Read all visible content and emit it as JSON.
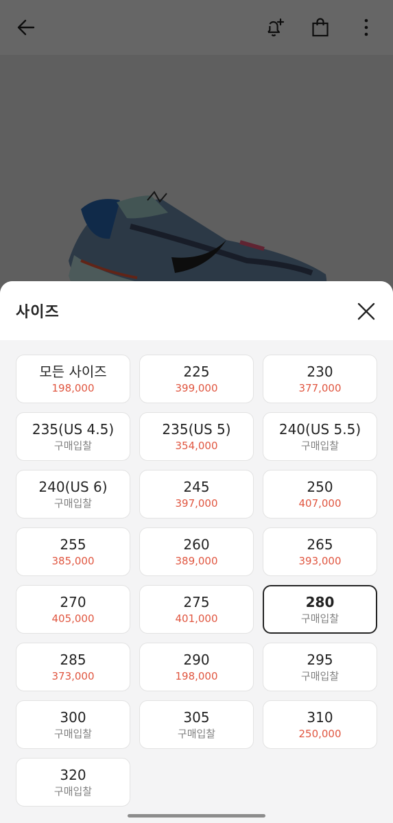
{
  "sheet": {
    "title": "사이즈",
    "close_icon": "close-icon"
  },
  "colors": {
    "price": "#e0553f",
    "bid": "#7f7f7f",
    "selected_border": "#222222"
  },
  "topbar_icons": [
    "back-arrow-icon",
    "bell-plus-icon",
    "shopping-bag-icon",
    "more-vertical-icon"
  ],
  "sizes": [
    {
      "label": "모든 사이즈",
      "sub": "198,000",
      "kind": "price",
      "selected": false
    },
    {
      "label": "225",
      "sub": "399,000",
      "kind": "price",
      "selected": false
    },
    {
      "label": "230",
      "sub": "377,000",
      "kind": "price",
      "selected": false
    },
    {
      "label": "235(US 4.5)",
      "sub": "구매입찰",
      "kind": "bid",
      "selected": false
    },
    {
      "label": "235(US 5)",
      "sub": "354,000",
      "kind": "price",
      "selected": false
    },
    {
      "label": "240(US 5.5)",
      "sub": "구매입찰",
      "kind": "bid",
      "selected": false
    },
    {
      "label": "240(US 6)",
      "sub": "구매입찰",
      "kind": "bid",
      "selected": false
    },
    {
      "label": "245",
      "sub": "397,000",
      "kind": "price",
      "selected": false
    },
    {
      "label": "250",
      "sub": "407,000",
      "kind": "price",
      "selected": false
    },
    {
      "label": "255",
      "sub": "385,000",
      "kind": "price",
      "selected": false
    },
    {
      "label": "260",
      "sub": "389,000",
      "kind": "price",
      "selected": false
    },
    {
      "label": "265",
      "sub": "393,000",
      "kind": "price",
      "selected": false
    },
    {
      "label": "270",
      "sub": "405,000",
      "kind": "price",
      "selected": false
    },
    {
      "label": "275",
      "sub": "401,000",
      "kind": "price",
      "selected": false
    },
    {
      "label": "280",
      "sub": "구매입찰",
      "kind": "bid",
      "selected": true
    },
    {
      "label": "285",
      "sub": "373,000",
      "kind": "price",
      "selected": false
    },
    {
      "label": "290",
      "sub": "198,000",
      "kind": "price",
      "selected": false
    },
    {
      "label": "295",
      "sub": "구매입찰",
      "kind": "bid",
      "selected": false
    },
    {
      "label": "300",
      "sub": "구매입찰",
      "kind": "bid",
      "selected": false
    },
    {
      "label": "305",
      "sub": "구매입찰",
      "kind": "bid",
      "selected": false
    },
    {
      "label": "310",
      "sub": "250,000",
      "kind": "price",
      "selected": false
    },
    {
      "label": "320",
      "sub": "구매입찰",
      "kind": "bid",
      "selected": false
    }
  ]
}
